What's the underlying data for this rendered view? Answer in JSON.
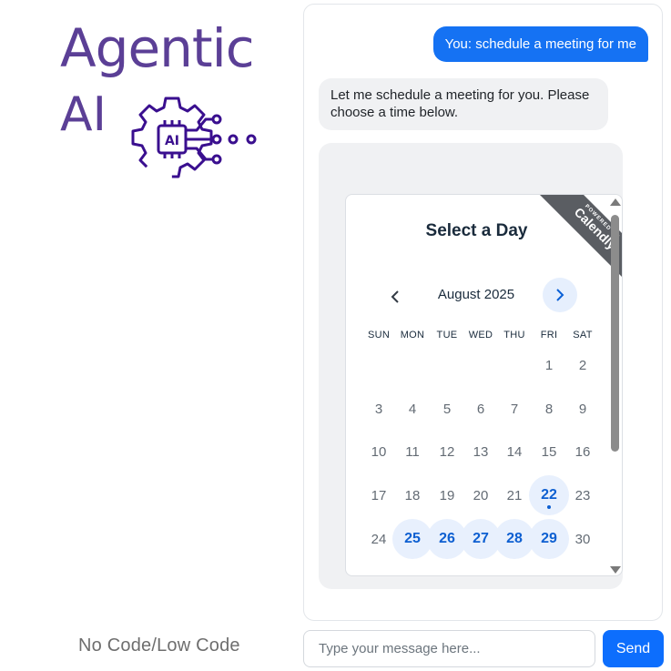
{
  "brand": {
    "title_line1": "Agentic",
    "title_line2": "AI",
    "logo_text": "AI",
    "tagline": "No Code/Low Code",
    "color": "#5b3f96"
  },
  "chat": {
    "user_message": "You: schedule a meeting for me",
    "bot_message": "Let me schedule a meeting for you. Please choose a time below."
  },
  "calendly": {
    "title": "Select a Day",
    "badge_small": "POWERED BY",
    "badge_big": "Calendly",
    "month": "August 2025",
    "prev_icon": "chevron-left-icon",
    "next_icon": "chevron-right-icon",
    "weekdays": [
      "SUN",
      "MON",
      "TUE",
      "WED",
      "THU",
      "FRI",
      "SAT"
    ],
    "weeks": [
      [
        "",
        "",
        "",
        "",
        "",
        "1",
        "2"
      ],
      [
        "3",
        "4",
        "5",
        "6",
        "7",
        "8",
        "9"
      ],
      [
        "10",
        "11",
        "12",
        "13",
        "14",
        "15",
        "16"
      ],
      [
        "17",
        "18",
        "19",
        "20",
        "21",
        "22",
        "23"
      ],
      [
        "24",
        "25",
        "26",
        "27",
        "28",
        "29",
        "30"
      ]
    ],
    "available_days": [
      "22",
      "25",
      "26",
      "27",
      "28",
      "29"
    ],
    "today": "22",
    "accent_color": "#0d5fd1"
  },
  "composer": {
    "placeholder": "Type your message here...",
    "send_label": "Send",
    "send_color": "#0d6efd"
  }
}
